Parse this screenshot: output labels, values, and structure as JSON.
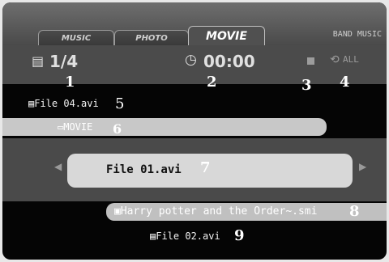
{
  "tabs": {
    "music": "MUSIC",
    "photo": "PHOTO",
    "movie": "MOVIE",
    "band_music": "BAND MUSIC"
  },
  "status": {
    "track_icon": "▤",
    "track_count": "1/4",
    "clock_icon": "◷",
    "time": "00:00",
    "repeat_icon": "⟲",
    "repeat_mode": "ALL"
  },
  "files": {
    "previous": "File 04.avi",
    "folder": "MOVIE",
    "selected": "File 01.avi",
    "subtitle": "Harry potter and the Order~.smi",
    "next": "File 02.avi"
  },
  "icons": {
    "file": "▤",
    "folder": "▭",
    "subtitle": "▣",
    "left_arrow": "◀",
    "right_arrow": "▶"
  },
  "callouts": [
    "1",
    "2",
    "3",
    "4",
    "5",
    "6",
    "7",
    "8",
    "9"
  ]
}
